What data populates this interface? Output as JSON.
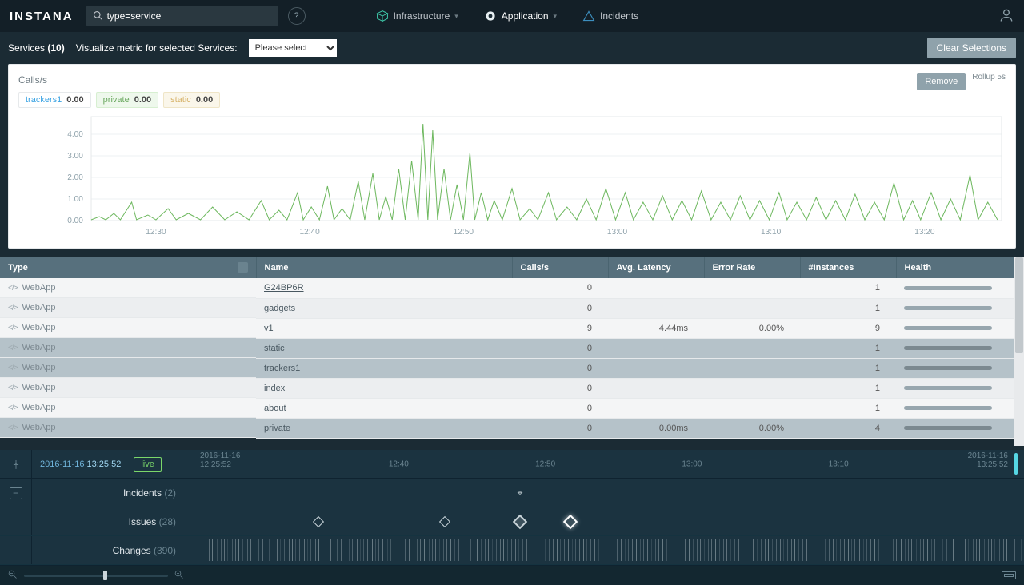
{
  "brand": "INSTANA",
  "search": {
    "value": "type=service"
  },
  "nav": {
    "infrastructure": "Infrastructure",
    "application": "Application",
    "incidents": "Incidents"
  },
  "toolbar": {
    "services_label": "Services",
    "services_count": "(10)",
    "metric_label": "Visualize metric for selected Services:",
    "metric_placeholder": "Please select",
    "clear_label": "Clear Selections"
  },
  "chart": {
    "title": "Calls/s",
    "tags": [
      {
        "name": "trackers1",
        "value": "0.00"
      },
      {
        "name": "private",
        "value": "0.00"
      },
      {
        "name": "static",
        "value": "0.00"
      }
    ],
    "remove_label": "Remove",
    "rollup_label": "Rollup 5s"
  },
  "chart_data": {
    "type": "line",
    "title": "Calls/s",
    "ylabel": "Calls/s",
    "xlabel": "",
    "ylim": [
      0,
      4.5
    ],
    "yticks": [
      0.0,
      1.0,
      2.0,
      3.0,
      4.0
    ],
    "x_categories": [
      "12:30",
      "12:40",
      "12:50",
      "13:00",
      "13:10",
      "13:20"
    ],
    "series": [
      {
        "name": "trackers1",
        "color": "#3aa3e3",
        "values_note": "near zero across range"
      },
      {
        "name": "private",
        "color": "#6aa85f",
        "values_note": "spiky; peaks near 4.3 around 12:48–12:52; mostly 0–1 elsewhere"
      },
      {
        "name": "static",
        "color": "#d7b36a",
        "values_note": "near zero across range"
      }
    ]
  },
  "table": {
    "columns": {
      "type": "Type",
      "name": "Name",
      "calls": "Calls/s",
      "latency": "Avg. Latency",
      "error": "Error Rate",
      "instances": "#Instances",
      "health": "Health"
    },
    "rows": [
      {
        "type": "WebApp",
        "name": "G24BP6R",
        "calls": "0",
        "latency": "",
        "error": "",
        "instances": "1",
        "selected": false
      },
      {
        "type": "WebApp",
        "name": "gadgets",
        "calls": "0",
        "latency": "",
        "error": "",
        "instances": "1",
        "selected": false
      },
      {
        "type": "WebApp",
        "name": "v1",
        "calls": "9",
        "latency": "4.44ms",
        "error": "0.00%",
        "instances": "9",
        "selected": false
      },
      {
        "type": "WebApp",
        "name": "static",
        "calls": "0",
        "latency": "",
        "error": "",
        "instances": "1",
        "selected": true
      },
      {
        "type": "WebApp",
        "name": "trackers1",
        "calls": "0",
        "latency": "",
        "error": "",
        "instances": "1",
        "selected": true
      },
      {
        "type": "WebApp",
        "name": "index",
        "calls": "0",
        "latency": "",
        "error": "",
        "instances": "1",
        "selected": false
      },
      {
        "type": "WebApp",
        "name": "about",
        "calls": "0",
        "latency": "",
        "error": "",
        "instances": "1",
        "selected": false
      },
      {
        "type": "WebApp",
        "name": "private",
        "calls": "0",
        "latency": "0.00ms",
        "error": "0.00%",
        "instances": "4",
        "selected": true
      }
    ]
  },
  "timeline": {
    "current_date": "2016-11-16",
    "current_time": "13:25:52",
    "live_label": "live",
    "range_start": {
      "date": "2016-11-16",
      "time": "12:25:52"
    },
    "range_end": {
      "date": "2016-11-16",
      "time": "13:25:52"
    },
    "ticks": [
      "12:40",
      "12:50",
      "13:00",
      "13:10"
    ],
    "rows": {
      "incidents": {
        "label": "Incidents",
        "count": "(2)"
      },
      "issues": {
        "label": "Issues",
        "count": "(28)"
      },
      "changes": {
        "label": "Changes",
        "count": "(390)"
      }
    }
  }
}
